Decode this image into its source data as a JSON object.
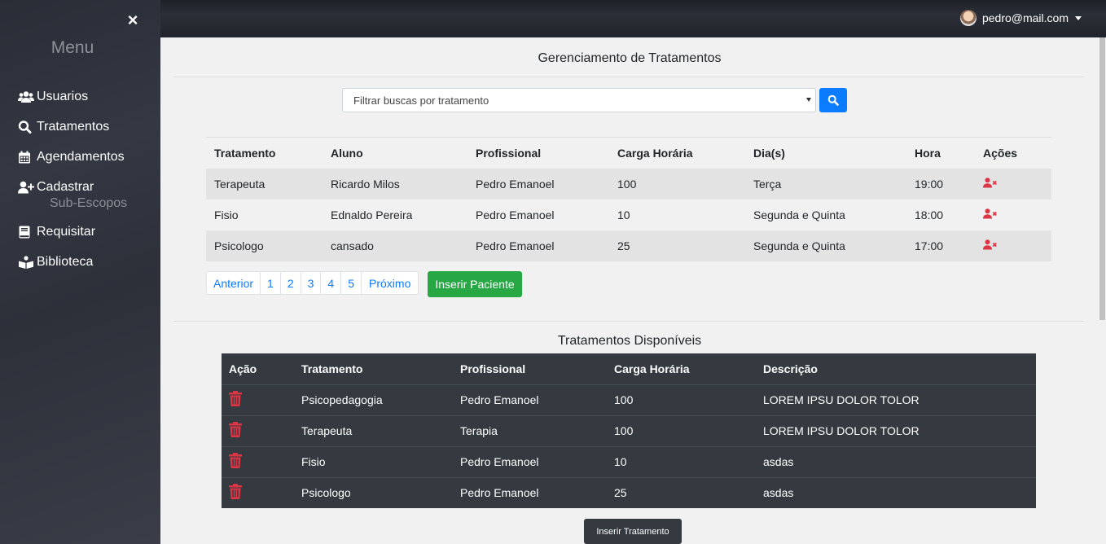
{
  "sidebar": {
    "close_label": "×",
    "menu_title": "Menu",
    "items": [
      {
        "label": "Usuarios",
        "icon": "users-icon"
      },
      {
        "label": "Tratamentos",
        "icon": "search-icon"
      },
      {
        "label": "Agendamentos",
        "icon": "calendar-icon"
      },
      {
        "label": "Cadastrar",
        "icon": "user-plus-icon"
      },
      {
        "label": "Requisitar",
        "icon": "book-icon"
      },
      {
        "label": "Biblioteca",
        "icon": "library-icon"
      }
    ],
    "sub_item": "Sub-Escopos"
  },
  "topbar": {
    "user_email": "pedro@mail.com"
  },
  "main": {
    "title": "Gerenciamento de Tratamentos",
    "filter_placeholder": "Filtrar buscas por tratamento",
    "table1": {
      "headers": [
        "Tratamento",
        "Aluno",
        "Profissional",
        "Carga Horária",
        "Dia(s)",
        "Hora",
        "Ações"
      ],
      "rows": [
        [
          "Terapeuta",
          "Ricardo Milos",
          "Pedro Emanoel",
          "100",
          "Terça",
          "19:00"
        ],
        [
          "Fisio",
          "Ednaldo Pereira",
          "Pedro Emanoel",
          "10",
          "Segunda e Quinta",
          "18:00"
        ],
        [
          "Psicologo",
          "cansado",
          "Pedro Emanoel",
          "25",
          "Segunda e Quinta",
          "17:00"
        ]
      ]
    },
    "pagination": {
      "prev": "Anterior",
      "pages": [
        "1",
        "2",
        "3",
        "4",
        "5"
      ],
      "next": "Próximo"
    },
    "insert_patient": "Inserir Paciente",
    "section2_title": "Tratamentos Disponíveis",
    "table2": {
      "headers": [
        "Ação",
        "Tratamento",
        "Profissional",
        "Carga Horária",
        "Descrição"
      ],
      "rows": [
        [
          "Psicopedagogia",
          "Pedro Emanoel",
          "100",
          "LOREM IPSU DOLOR TOLOR"
        ],
        [
          "Terapeuta",
          "Terapia",
          "100",
          "LOREM IPSU DOLOR TOLOR"
        ],
        [
          "Fisio",
          "Pedro Emanoel",
          "10",
          "asdas"
        ],
        [
          "Psicologo",
          "Pedro Emanoel",
          "25",
          "asdas"
        ]
      ]
    },
    "insert_treatment": "Inserir Tratamento"
  },
  "colors": {
    "primary": "#0b7bff",
    "success": "#28a745",
    "danger": "#dc3545",
    "dark": "#343a40"
  }
}
